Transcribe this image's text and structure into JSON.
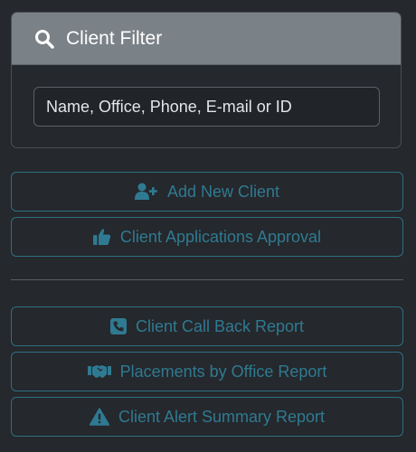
{
  "filter": {
    "title": "Client Filter",
    "placeholder": "Name, Office, Phone, E-mail or ID",
    "value": ""
  },
  "buttons": {
    "add_new_client": "Add New Client",
    "applications_approval": "Client Applications Approval",
    "call_back_report": "Client Call Back Report",
    "placements_report": "Placements by Office Report",
    "alert_summary_report": "Client Alert Summary Report"
  },
  "colors": {
    "background": "#25282c",
    "header": "#7a8187",
    "accent": "#2f7a92"
  },
  "icons": {
    "filter": "search-icon",
    "add_new_client": "user-plus-icon",
    "applications_approval": "thumbs-up-icon",
    "call_back_report": "phone-square-icon",
    "placements_report": "handshake-icon",
    "alert_summary_report": "warning-icon"
  }
}
